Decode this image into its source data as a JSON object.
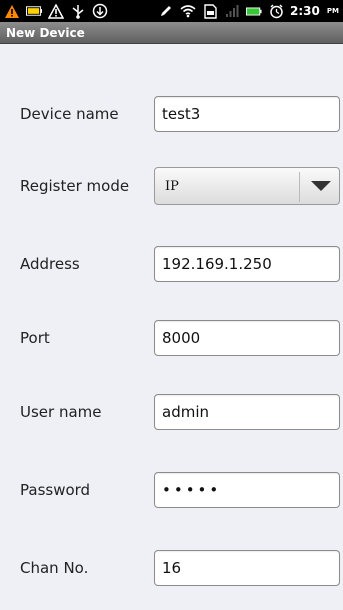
{
  "status_bar": {
    "time": "2:30",
    "ampm": "PM",
    "icons_left": [
      "warning-icon",
      "battery-level-icon",
      "alert-icon",
      "usb-icon",
      "download-icon"
    ],
    "icons_right": [
      "sync-icon",
      "wifi-icon",
      "sd-card-icon",
      "signal-icon",
      "battery-icon",
      "alarm-icon"
    ]
  },
  "title_bar": {
    "title": "New Device"
  },
  "form": {
    "device_name": {
      "label": "Device name",
      "value": "test3"
    },
    "register_mode": {
      "label": "Register mode",
      "value": "IP"
    },
    "address": {
      "label": "Address",
      "value": "192.169.1.250"
    },
    "port": {
      "label": "Port",
      "value": "8000"
    },
    "user_name": {
      "label": "User name",
      "value": "admin"
    },
    "password": {
      "label": "Password",
      "value": "•••••"
    },
    "chan_no": {
      "label": "Chan No.",
      "value": "16"
    }
  },
  "colors": {
    "background": "#eef0f5",
    "status_bar": "#000000",
    "title_bar": "#6f6f6f",
    "warning": "#ff8a00",
    "battery_green": "#37c837"
  }
}
